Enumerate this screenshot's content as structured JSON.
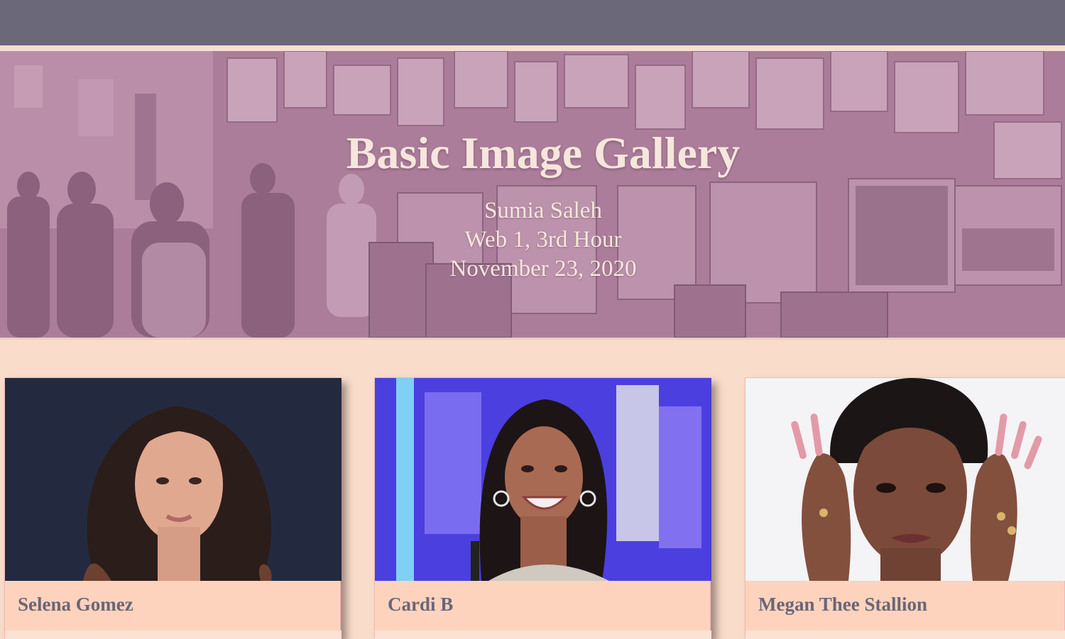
{
  "header": {
    "title": "Basic Image Gallery",
    "author": "Sumia Saleh",
    "course": "Web 1, 3rd Hour",
    "date": "November 23, 2020"
  },
  "gallery": [
    {
      "caption": "Selena Gomez",
      "image": "portrait-photo"
    },
    {
      "caption": "Cardi B",
      "image": "portrait-photo"
    },
    {
      "caption": "Megan Thee Stallion",
      "image": "portrait-photo"
    }
  ],
  "colors": {
    "topbar": "#6a6879",
    "hero_tint": "#a27a95",
    "page_background": "#f9dcc9",
    "card_background": "#fdd3bd",
    "caption_text": "#6b6678",
    "title_text": "#f6e6dc"
  }
}
